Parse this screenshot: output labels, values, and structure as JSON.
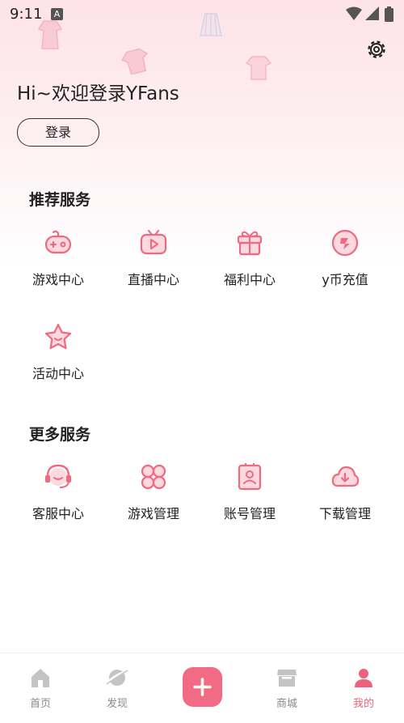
{
  "status_bar": {
    "time": "9:11",
    "notification_badge": "A"
  },
  "header": {
    "greeting": "Hi~欢迎登录YFans",
    "login_label": "登录",
    "settings_icon": "gear-icon"
  },
  "recommended": {
    "title": "推荐服务",
    "items": [
      {
        "label": "游戏中心",
        "icon": "gamepad-icon"
      },
      {
        "label": "直播中心",
        "icon": "tv-play-icon"
      },
      {
        "label": "福利中心",
        "icon": "gift-icon"
      },
      {
        "label": "y币充值",
        "icon": "coin-icon"
      },
      {
        "label": "活动中心",
        "icon": "star-icon"
      }
    ]
  },
  "more": {
    "title": "更多服务",
    "items": [
      {
        "label": "客服中心",
        "icon": "headset-icon"
      },
      {
        "label": "游戏管理",
        "icon": "apps-grid-icon"
      },
      {
        "label": "账号管理",
        "icon": "account-card-icon"
      },
      {
        "label": "下载管理",
        "icon": "cloud-download-icon"
      }
    ]
  },
  "tabbar": {
    "tabs": [
      {
        "label": "首页",
        "icon": "home-icon"
      },
      {
        "label": "发现",
        "icon": "planet-icon"
      },
      {
        "label": "",
        "icon": "plus-icon"
      },
      {
        "label": "商城",
        "icon": "shop-icon"
      },
      {
        "label": "我的",
        "icon": "user-icon",
        "active": true
      }
    ]
  },
  "colors": {
    "accent": "#f26b84",
    "icon_stroke": "#ee6a80",
    "active_tab": "#f0607a",
    "inactive_tab": "#c4c4c4"
  }
}
